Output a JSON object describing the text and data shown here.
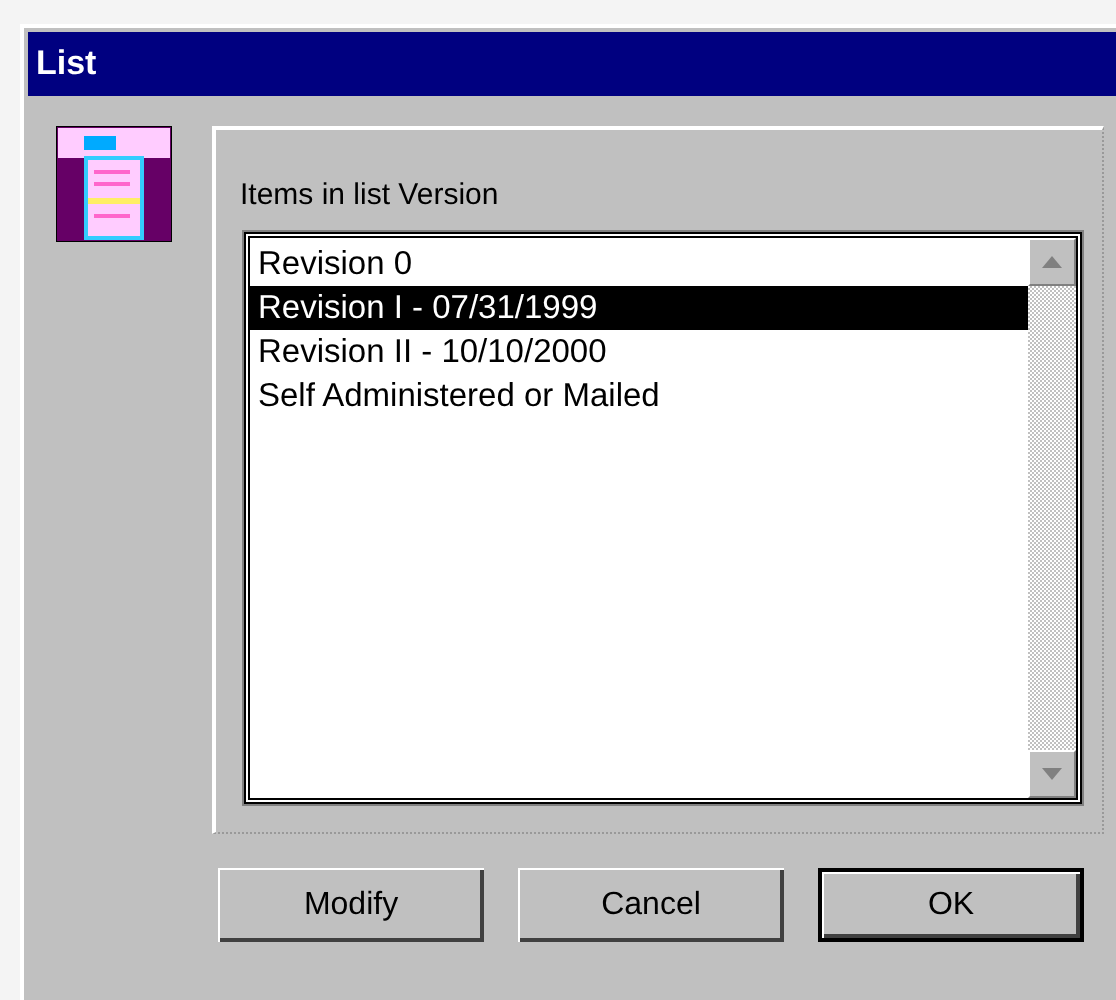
{
  "window": {
    "title": "List"
  },
  "list_label": "Items in list Version",
  "items": [
    {
      "label": "Revision 0",
      "selected": false
    },
    {
      "label": "Revision I - 07/31/1999",
      "selected": true
    },
    {
      "label": "Revision II - 10/10/2000",
      "selected": false
    },
    {
      "label": "Self Administered or Mailed",
      "selected": false
    }
  ],
  "buttons": [
    {
      "label": "Modify",
      "default": false
    },
    {
      "label": "Cancel",
      "default": false
    },
    {
      "label": "OK",
      "default": true
    }
  ]
}
